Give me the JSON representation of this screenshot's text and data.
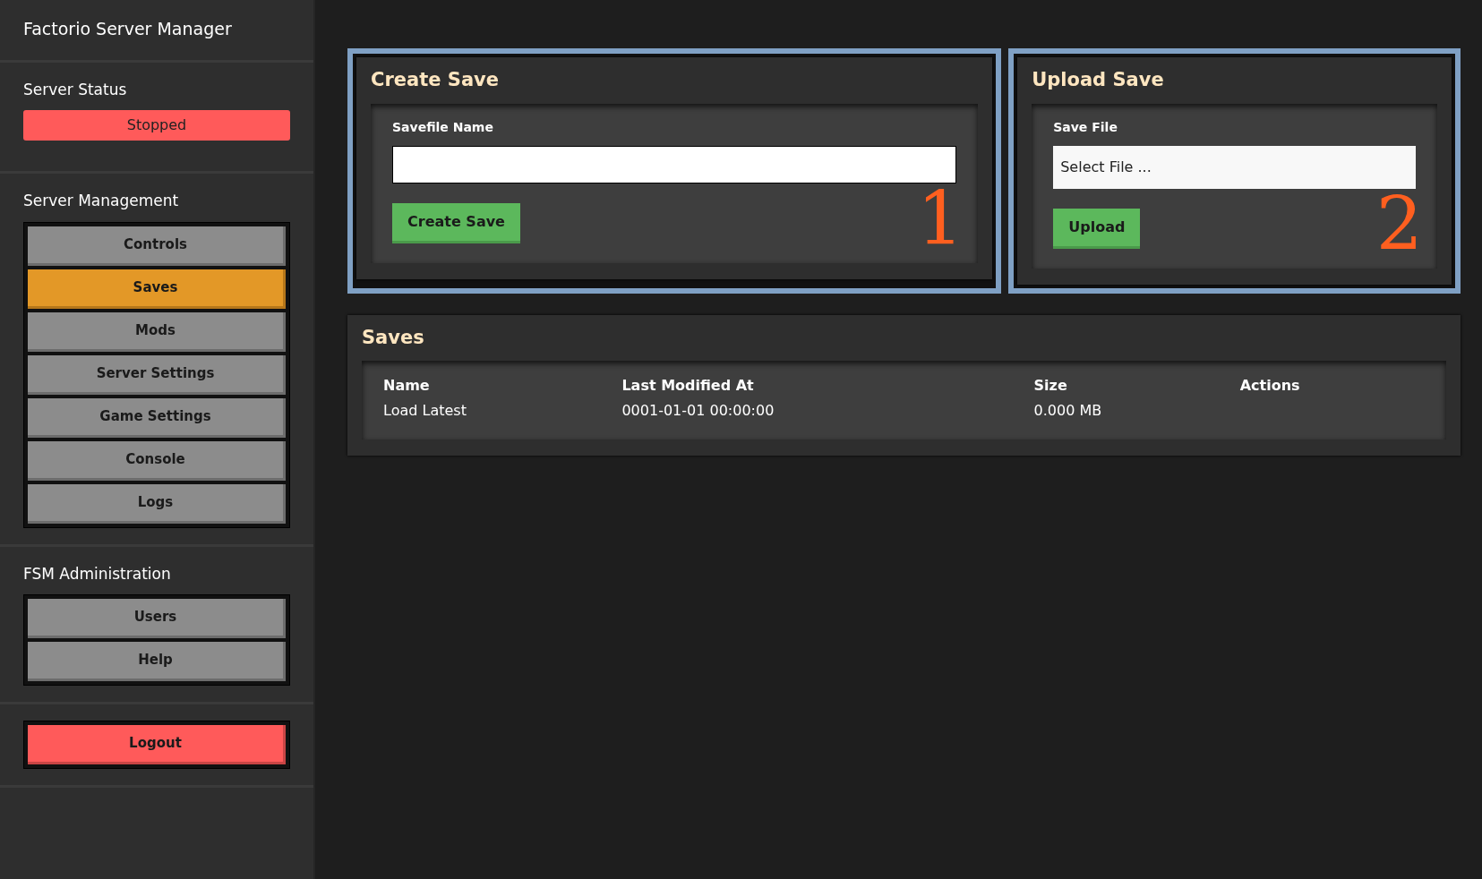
{
  "app_title": "Factorio Server Manager",
  "server_status": {
    "heading": "Server Status",
    "label": "Stopped",
    "running": false
  },
  "sections": [
    {
      "heading": "Server Management",
      "items": [
        {
          "label": "Controls",
          "selected": false
        },
        {
          "label": "Saves",
          "selected": true
        },
        {
          "label": "Mods",
          "selected": false
        },
        {
          "label": "Server Settings",
          "selected": false
        },
        {
          "label": "Game Settings",
          "selected": false
        },
        {
          "label": "Console",
          "selected": false
        },
        {
          "label": "Logs",
          "selected": false
        }
      ]
    },
    {
      "heading": "FSM Administration",
      "items": [
        {
          "label": "Users",
          "selected": false
        },
        {
          "label": "Help",
          "selected": false
        }
      ]
    }
  ],
  "logout": "Logout",
  "panels": [
    {
      "kind": "create",
      "title": "Create Save",
      "field_label": "Savefile Name",
      "button": "Create Save",
      "callout": "1"
    },
    {
      "kind": "upload",
      "title": "Upload Save",
      "field_label": "Save File",
      "placeholder": "Select File ...",
      "button": "Upload",
      "callout": "2"
    }
  ],
  "saves": {
    "title": "Saves",
    "columns": [
      "Name",
      "Last Modified At",
      "Size",
      "Actions"
    ],
    "rows": [
      [
        "Load Latest",
        "0001-01-01 00:00:00",
        "0.000 MB"
      ]
    ]
  }
}
